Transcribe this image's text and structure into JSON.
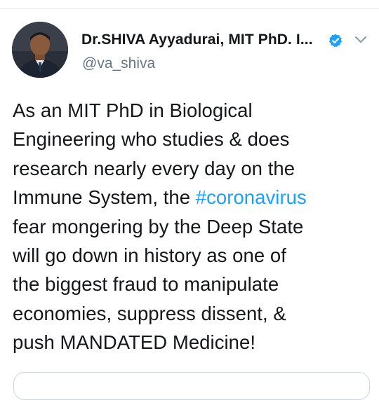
{
  "tweet": {
    "author": {
      "display_name": "Dr.SHIVA Ayyadurai, MIT PhD. I...",
      "handle": "@va_shiva",
      "verified": true,
      "avatar_icon": "profile-photo"
    },
    "text_lines": [
      {
        "text": "As an MIT PhD in Biological"
      },
      {
        "text": "Engineering who studies & does"
      },
      {
        "text": "research nearly every day on the"
      },
      {
        "before": "Immune System, the ",
        "hashtag": "#coronavirus"
      },
      {
        "text": "fear mongering by the Deep State"
      },
      {
        "text": "will go down in history as one of"
      },
      {
        "text": "the biggest fraud to manipulate"
      },
      {
        "text": "economies, suppress dissent, &"
      },
      {
        "text": "push MANDATED Medicine!"
      }
    ]
  },
  "icons": {
    "verified": "verified-badge-icon",
    "menu": "chevron-down-icon"
  },
  "colors": {
    "text": "#14171a",
    "secondary_text": "#657786",
    "link": "#1da1f2",
    "border": "#ccd6dd"
  }
}
